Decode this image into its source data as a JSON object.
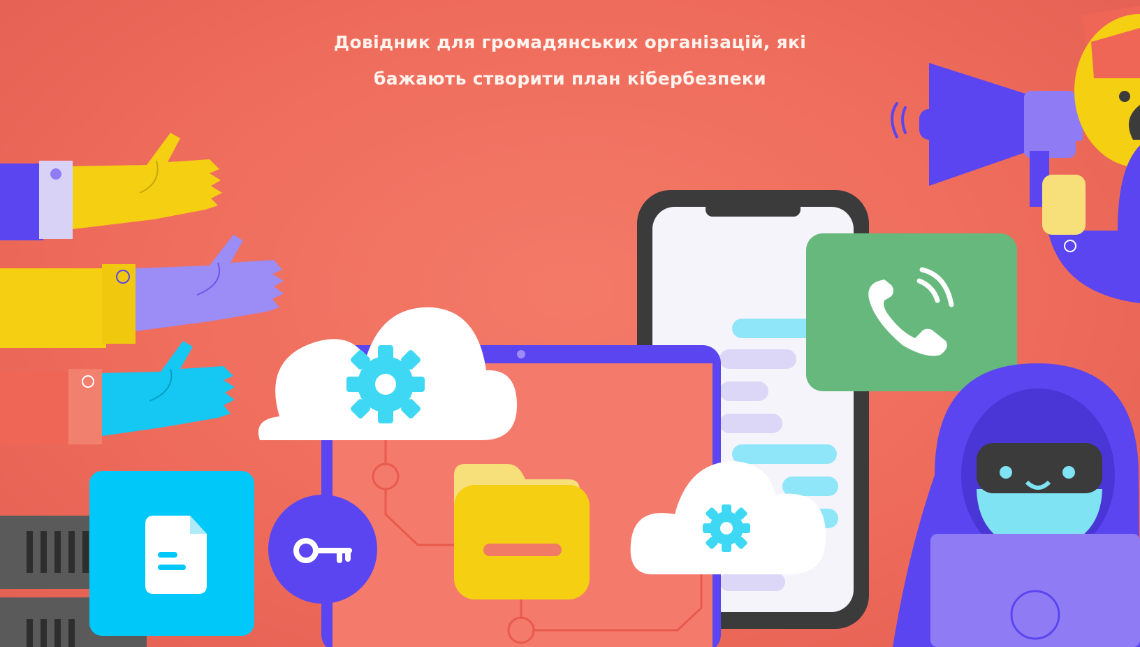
{
  "headline": {
    "line1": "Довідник для громадянських організацій, які",
    "line2": "бажають створити план кібербезпеки"
  },
  "colors": {
    "background": "#ef6e5e",
    "yellow": "#f5cf12",
    "purple": "#5b45f0",
    "lavender": "#9b8cf6",
    "cyan": "#14c8f3",
    "green": "#66b87c",
    "dark": "#3b3b3b",
    "white": "#ffffff"
  },
  "icons": [
    "hand-yellow-icon",
    "hand-lavender-icon",
    "hand-cyan-icon",
    "cloud-gear-icon",
    "document-icon",
    "key-icon",
    "folder-icon",
    "tablet-icon",
    "smartphone-icon",
    "phone-call-icon",
    "megaphone-icon",
    "cat-character-icon",
    "hacker-icon",
    "laptop-icon",
    "server-rack-icon"
  ]
}
